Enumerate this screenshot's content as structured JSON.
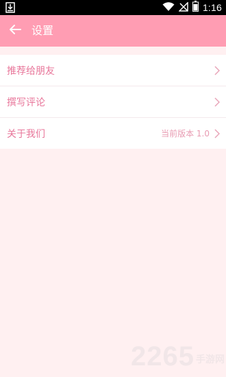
{
  "status_bar": {
    "time": "1:16",
    "icons": [
      "download-icon",
      "wifi-icon",
      "no-sim-icon",
      "battery-icon"
    ]
  },
  "header": {
    "title": "设置",
    "back_icon": "arrow-left-icon",
    "background": "#ff9db3"
  },
  "settings": {
    "items": [
      {
        "label": "推荐给朋友",
        "value": ""
      },
      {
        "label": "撰写评论",
        "value": ""
      },
      {
        "label": "关于我们",
        "value": "当前版本 1.0"
      }
    ],
    "chevron_icon": "chevron-right-icon"
  },
  "watermark": {
    "number": "2265",
    "suffix": "手游网"
  },
  "colors": {
    "accent": "#ff9db3",
    "text": "#e8769a",
    "page_background": "#fff0f1"
  }
}
